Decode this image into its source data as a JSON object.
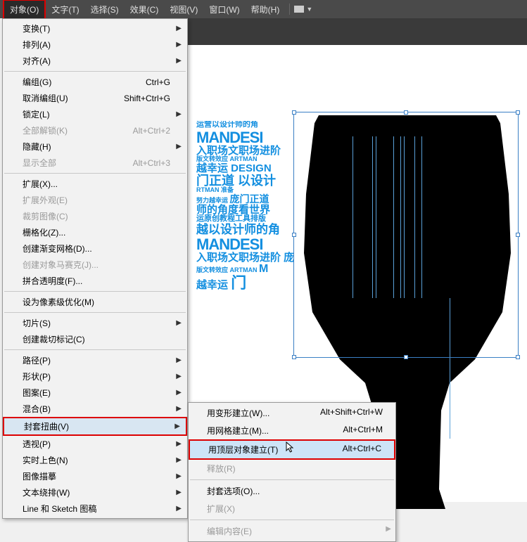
{
  "menubar": {
    "items": [
      "对象(O)",
      "文字(T)",
      "选择(S)",
      "效果(C)",
      "视图(V)",
      "窗口(W)",
      "帮助(H)"
    ]
  },
  "dropdown": {
    "groups": [
      [
        {
          "label": "变换(T)",
          "sub": true
        },
        {
          "label": "排列(A)",
          "sub": true
        },
        {
          "label": "对齐(A)",
          "sub": true
        }
      ],
      [
        {
          "label": "编组(G)",
          "shortcut": "Ctrl+G"
        },
        {
          "label": "取消编组(U)",
          "shortcut": "Shift+Ctrl+G"
        },
        {
          "label": "锁定(L)",
          "sub": true
        },
        {
          "label": "全部解锁(K)",
          "shortcut": "Alt+Ctrl+2",
          "disabled": true
        },
        {
          "label": "隐藏(H)",
          "sub": true
        },
        {
          "label": "显示全部",
          "shortcut": "Alt+Ctrl+3",
          "disabled": true
        }
      ],
      [
        {
          "label": "扩展(X)..."
        },
        {
          "label": "扩展外观(E)",
          "disabled": true
        },
        {
          "label": "裁剪图像(C)",
          "disabled": true
        },
        {
          "label": "栅格化(Z)..."
        },
        {
          "label": "创建渐变网格(D)..."
        },
        {
          "label": "创建对象马赛克(J)...",
          "disabled": true
        },
        {
          "label": "拼合透明度(F)..."
        }
      ],
      [
        {
          "label": "设为像素级优化(M)"
        }
      ],
      [
        {
          "label": "切片(S)",
          "sub": true
        },
        {
          "label": "创建裁切标记(C)"
        }
      ],
      [
        {
          "label": "路径(P)",
          "sub": true
        },
        {
          "label": "形状(P)",
          "sub": true
        },
        {
          "label": "图案(E)",
          "sub": true
        },
        {
          "label": "混合(B)",
          "sub": true
        },
        {
          "label": "封套扭曲(V)",
          "sub": true,
          "highlight": true,
          "hover": true
        },
        {
          "label": "透视(P)",
          "sub": true
        },
        {
          "label": "实时上色(N)",
          "sub": true
        },
        {
          "label": "图像描摹",
          "sub": true
        },
        {
          "label": "文本绕排(W)",
          "sub": true
        },
        {
          "label": "Line 和 Sketch 图稿",
          "sub": true
        }
      ]
    ]
  },
  "submenu": {
    "items": [
      {
        "label": "用变形建立(W)...",
        "shortcut": "Alt+Shift+Ctrl+W"
      },
      {
        "label": "用网格建立(M)...",
        "shortcut": "Alt+Ctrl+M"
      },
      {
        "label": "用顶层对象建立(T)",
        "shortcut": "Alt+Ctrl+C",
        "highlight": true,
        "hover": true
      },
      {
        "label": "释放(R)",
        "disabled": true
      }
    ],
    "items2": [
      {
        "label": "封套选项(O)..."
      },
      {
        "label": "扩展(X)",
        "disabled": true
      }
    ],
    "items3": [
      {
        "label": "编辑内容(E)",
        "disabled": true,
        "sub": true
      }
    ]
  },
  "collage": {
    "l1": "运营以设计师的角",
    "l2": "MANDESI",
    "l3": "入职场文职场进阶",
    "l4a": "版文转效应 ARTMAN",
    "l4b": "越幸运 DESIGN",
    "l5": "门正道 以设计",
    "l6": "RTMAN 准备",
    "l7a": "努力越幸运",
    "l7b": "庞门正道",
    "l8": "师的角度看世界",
    "l9": "运原创教程工具排版",
    "l10": "越以设计师的角",
    "l11": "MANDESI",
    "l12": "入职场文职场进阶 庞",
    "l13a": "版文转效应 ARTMAN",
    "l13b": "M",
    "l14": "越幸运",
    "l14b": "门"
  }
}
